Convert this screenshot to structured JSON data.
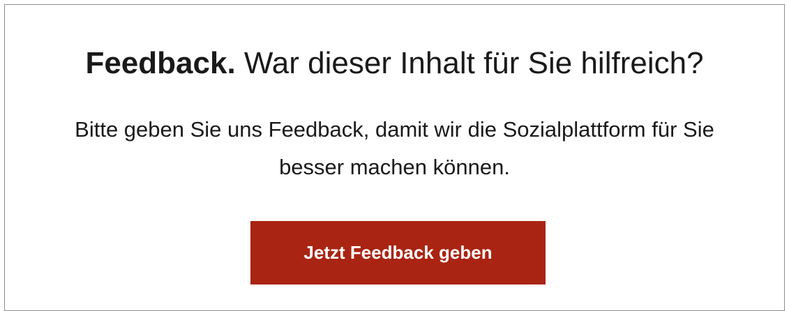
{
  "feedback": {
    "title_strong": "Feedback.",
    "title_rest": " War dieser Inhalt für Sie hilfreich?",
    "description_line_1": "Bitte geben Sie uns Feedback, damit wir die Sozialplattform für Sie",
    "description_line_2": "besser machen können.",
    "button_label": "Jetzt Feedback geben"
  },
  "colors": {
    "button_background": "#a92412",
    "button_text": "#ffffff",
    "text": "#1a1a1a",
    "border": "#8c8c8c"
  }
}
